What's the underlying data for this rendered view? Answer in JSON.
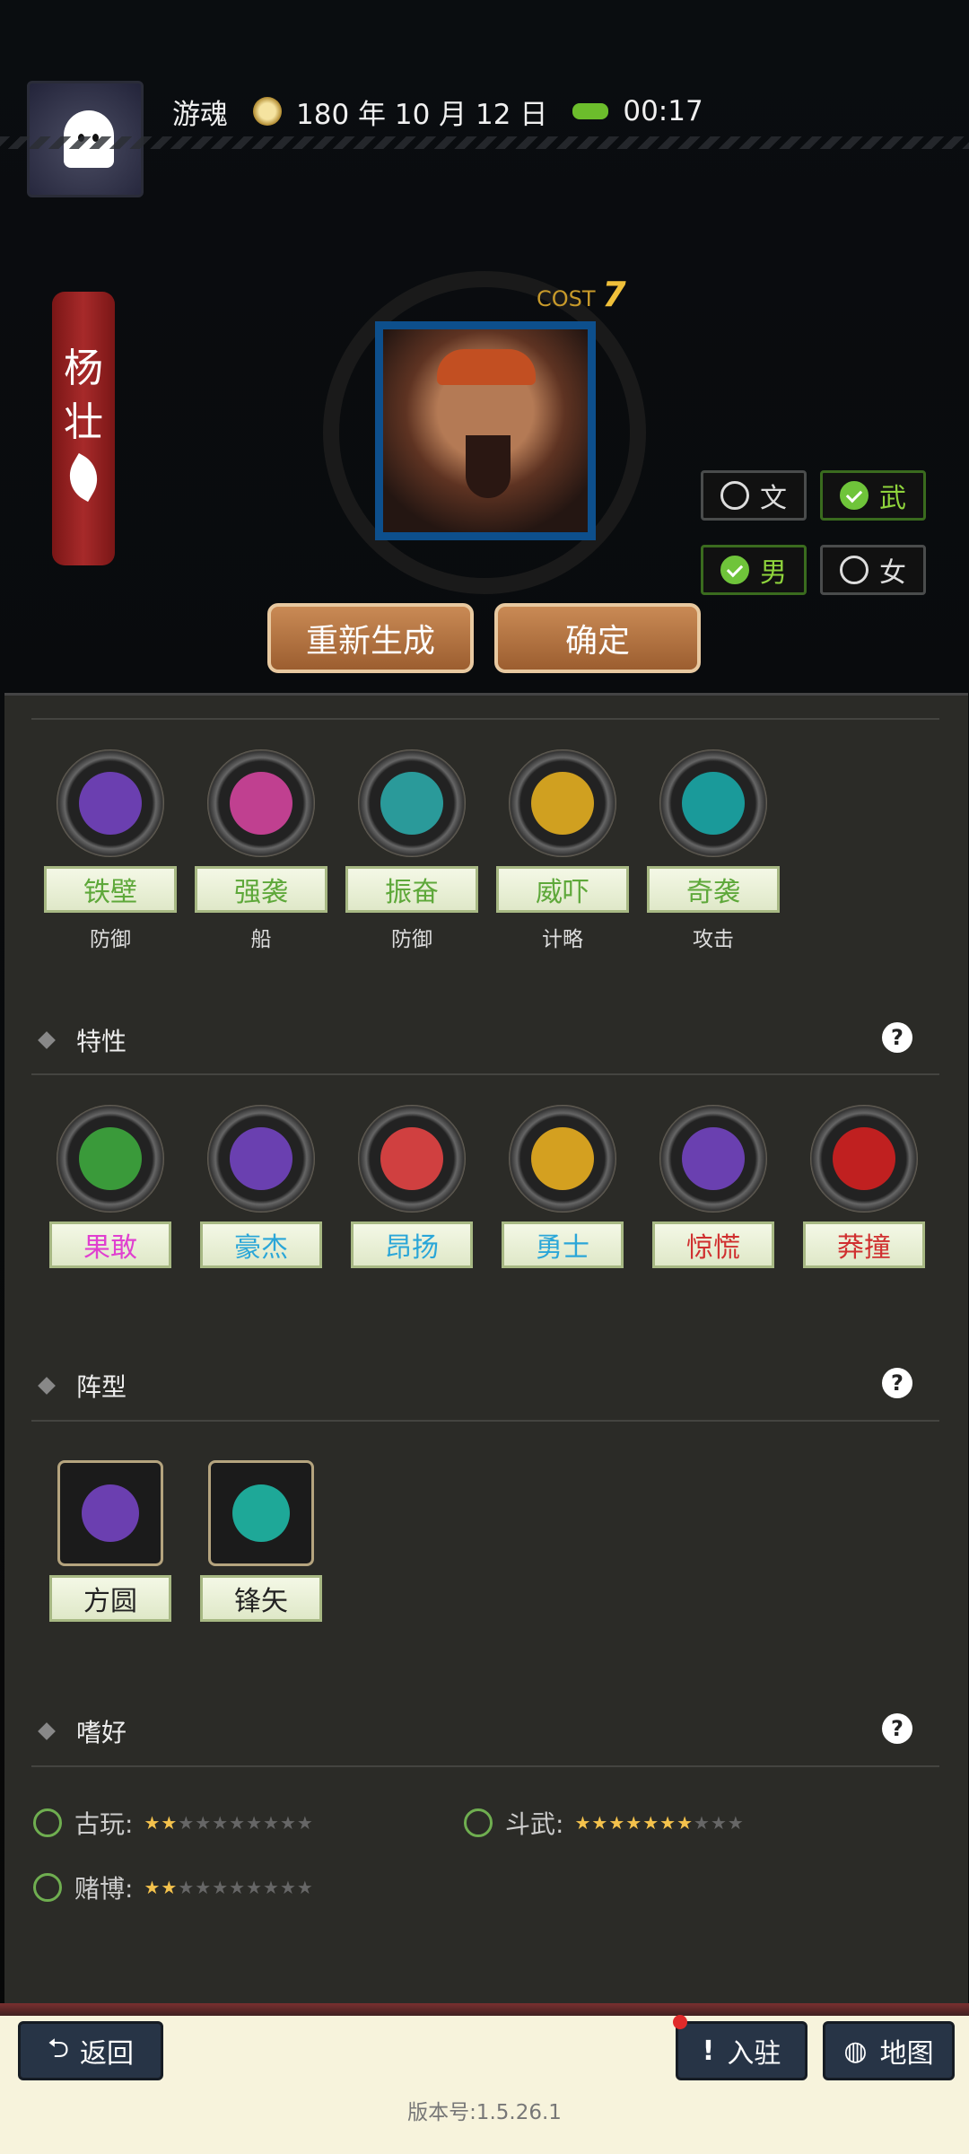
{
  "header": {
    "player": "游魂",
    "date": "180 年 10 月 12 日",
    "time": "00:17"
  },
  "general": {
    "name_line1": "杨",
    "name_line2": "壮",
    "cost_label": "COST",
    "cost_value": "7"
  },
  "toggles": {
    "wen": "文",
    "wu": "武",
    "male": "男",
    "female": "女"
  },
  "actions": {
    "regenerate": "重新生成",
    "confirm": "确定"
  },
  "skills": [
    {
      "name": "铁壁",
      "type": "防御",
      "color": "#5ea83a",
      "icon": "turtle-shell-icon"
    },
    {
      "name": "强袭",
      "type": "船",
      "color": "#5ea83a",
      "icon": "wave-rider-icon"
    },
    {
      "name": "振奋",
      "type": "防御",
      "color": "#5ea83a",
      "icon": "shouting-face-icon"
    },
    {
      "name": "威吓",
      "type": "计略",
      "color": "#5ea83a",
      "icon": "roaring-mask-icon"
    },
    {
      "name": "奇袭",
      "type": "攻击",
      "color": "#5ea83a",
      "icon": "blue-flame-icon"
    }
  ],
  "traits_title": "特性",
  "traits": [
    {
      "name": "果敢",
      "color": "#e040d0",
      "icon": "muscle-man-icon"
    },
    {
      "name": "豪杰",
      "color": "#2aa6d8",
      "icon": "battle-axe-icon"
    },
    {
      "name": "昂扬",
      "color": "#2aa6d8",
      "icon": "blood-rocks-icon"
    },
    {
      "name": "勇士",
      "color": "#2aa6d8",
      "icon": "horned-helmet-icon"
    },
    {
      "name": "惊慌",
      "color": "#d03030",
      "icon": "koala-icon"
    },
    {
      "name": "莽撞",
      "color": "#d03030",
      "icon": "red-totem-icon"
    }
  ],
  "formation_title": "阵型",
  "formations": [
    {
      "name": "方圆",
      "icon": "turtle-formation-icon"
    },
    {
      "name": "锋矢",
      "icon": "arrowhead-formation-icon"
    }
  ],
  "hobby_title": "嗜好",
  "hobbies": [
    {
      "label": "古玩:",
      "rating": 1.5,
      "max": 10
    },
    {
      "label": "斗武:",
      "rating": 6.5,
      "max": 10
    },
    {
      "label": "赌博:",
      "rating": 2,
      "max": 10
    }
  ],
  "footer": {
    "back": "返回",
    "settle": "入驻",
    "map": "地图",
    "version": "版本号:1.5.26.1"
  }
}
